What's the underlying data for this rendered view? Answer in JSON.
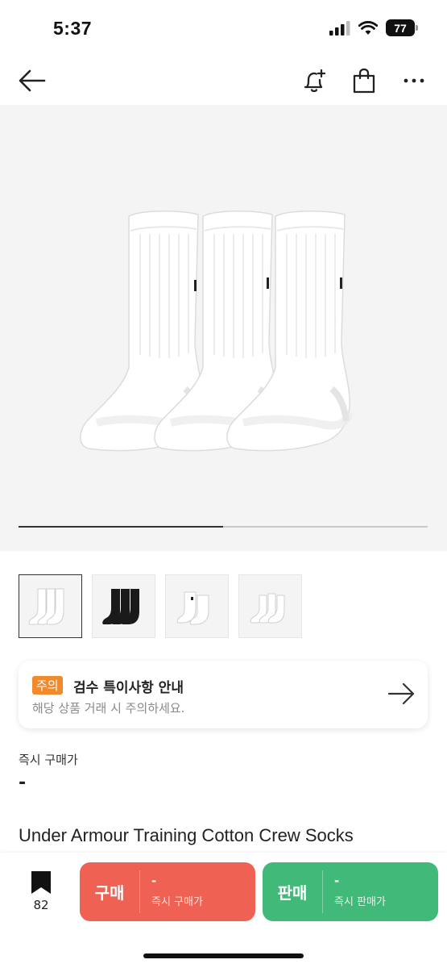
{
  "status_bar": {
    "time": "5:37",
    "battery": "77",
    "icons": [
      "signal-icon",
      "wifi-icon",
      "battery-icon"
    ]
  },
  "nav": {
    "icons": [
      "back-arrow-icon",
      "bell-plus-icon",
      "shopping-bag-icon",
      "more-icon"
    ]
  },
  "gallery": {
    "progress_fraction": 0.5,
    "thumbnails": [
      {
        "variant": "white-3-pack",
        "selected": true
      },
      {
        "variant": "black-3-pack",
        "selected": false
      },
      {
        "variant": "white-quarter-2-pack",
        "selected": false
      },
      {
        "variant": "white-quarter-3-pack",
        "selected": false
      }
    ]
  },
  "notice": {
    "badge": "주의",
    "title": "검수 특이사항 안내",
    "subtitle": "해당 상품 거래 시 주의하세요."
  },
  "price": {
    "label": "즉시 구매가",
    "value": "-"
  },
  "product": {
    "name": "Under Armour Training Cotton Crew Socks"
  },
  "bottom_bar": {
    "bookmark_count": "82",
    "buy": {
      "label": "구매",
      "price": "-",
      "sub": "즉시 구매가",
      "color": "#ef6253"
    },
    "sell": {
      "label": "판매",
      "price": "-",
      "sub": "즉시 판매가",
      "color": "#41b979"
    }
  }
}
